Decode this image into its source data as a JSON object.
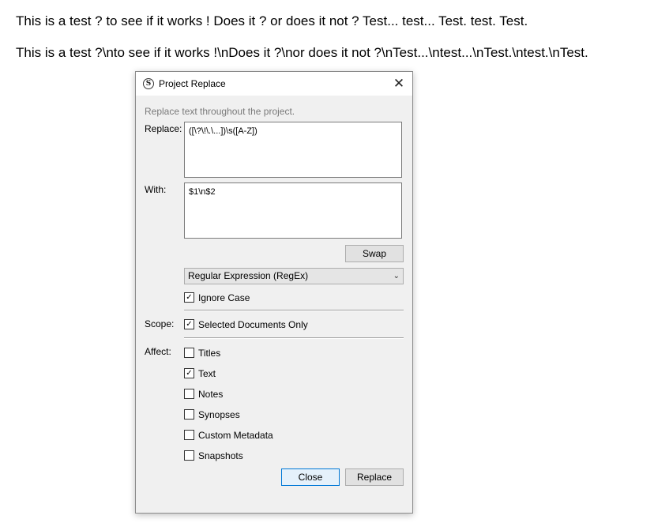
{
  "document": {
    "line1": "This is a test ? to see if it works ! Does it ? or does it not ? Test... test... Test. test. Test.",
    "line2": "This is a test ?\\nto see if it works !\\nDoes it ?\\nor does it not ?\\nTest...\\ntest...\\nTest.\\ntest.\\nTest."
  },
  "dialog": {
    "title": "Project Replace",
    "app_icon": "scrivener-s-icon",
    "app_icon_glyph": "S",
    "close_glyph": "✕",
    "hint": "Replace text throughout the project.",
    "replace_label": "Replace:",
    "replace_value": "([\\?\\!\\.\\...])\\s([A-Z])",
    "with_label": "With:",
    "with_value": "$1\\n$2",
    "swap_label": "Swap",
    "mode_selected": "Regular Expression (RegEx)",
    "ignore_case": {
      "label": "Ignore Case",
      "checked": true
    },
    "scope_label": "Scope:",
    "selected_docs_only": {
      "label": "Selected Documents Only",
      "checked": true
    },
    "affect_label": "Affect:",
    "affect_options": [
      {
        "label": "Titles",
        "checked": false
      },
      {
        "label": "Text",
        "checked": true
      },
      {
        "label": "Notes",
        "checked": false
      },
      {
        "label": "Synopses",
        "checked": false
      },
      {
        "label": "Custom Metadata",
        "checked": false
      },
      {
        "label": "Snapshots",
        "checked": false
      }
    ],
    "close_label": "Close",
    "replace_button_label": "Replace"
  }
}
